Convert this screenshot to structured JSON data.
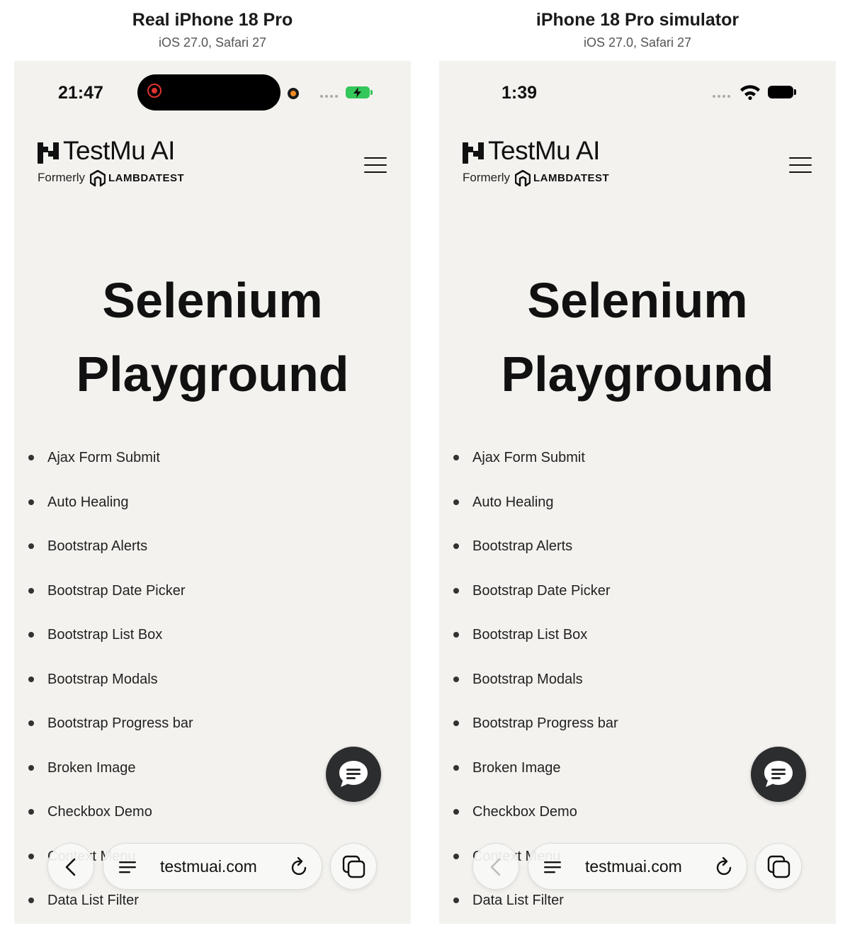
{
  "panels": [
    {
      "title": "Real iPhone 18 Pro",
      "subtitle": "iOS 27.0, Safari 27",
      "status_time": "21:47"
    },
    {
      "title": "iPhone 18 Pro simulator",
      "subtitle": "iOS 27.0, Safari 27",
      "status_time": "1:39"
    }
  ],
  "brand": {
    "name": "TestMu AI",
    "formerly": "Formerly",
    "former_name": "LAMBDATEST"
  },
  "page": {
    "title_line1": "Selenium",
    "title_line2": "Playground",
    "links": [
      "Ajax Form Submit",
      "Auto Healing",
      "Bootstrap Alerts",
      "Bootstrap Date Picker",
      "Bootstrap List Box",
      "Bootstrap Modals",
      "Bootstrap Progress bar",
      "Broken Image",
      "Checkbox Demo",
      "Context Menu",
      "Data List Filter"
    ]
  },
  "browser": {
    "domain": "testmuai.com"
  },
  "colors": {
    "page_bg": "#f3f2ee",
    "chat_button": "#2c2d2f",
    "battery_charging": "#34c759",
    "recording": "#e0322f"
  },
  "icons": [
    "record-icon",
    "camera-dot-icon",
    "battery-charging-icon",
    "wifi-icon",
    "battery-icon",
    "hamburger-icon",
    "chat-icon",
    "back-chevron-icon",
    "page-menu-icon",
    "reload-icon",
    "tabs-icon"
  ]
}
